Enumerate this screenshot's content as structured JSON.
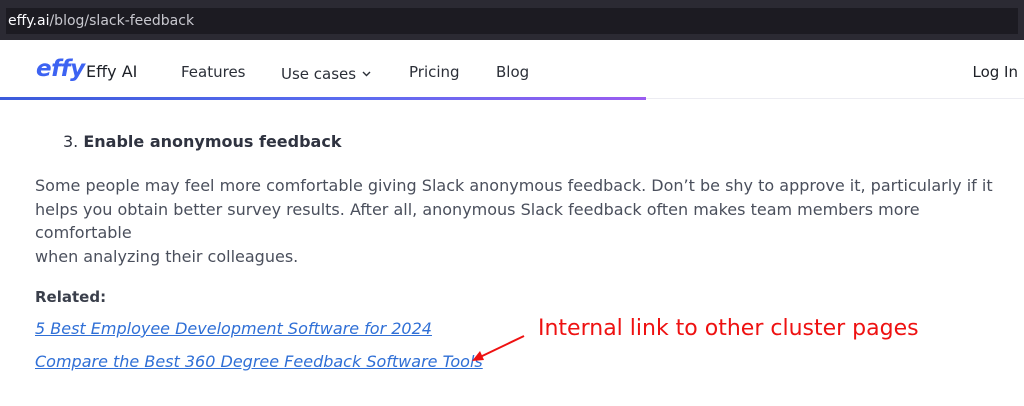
{
  "browser": {
    "url_host": "effy.ai",
    "url_path": "/blog/slack-feedback"
  },
  "nav": {
    "logo_text": "effy",
    "brand": "Effy AI",
    "links": [
      "Features",
      "Use cases",
      "Pricing",
      "Blog"
    ],
    "login": "Log In",
    "accent": "#3d63f2"
  },
  "article": {
    "step_number": "3.",
    "step_title": "Enable anonymous feedback",
    "paragraph_lines": [
      "Some people may feel more comfortable giving Slack anonymous feedback. Don’t be shy to approve it, particularly if it",
      "helps you obtain better survey results. After all, anonymous Slack feedback often makes team members more comfortable",
      "when analyzing their colleagues."
    ],
    "related_label": "Related:",
    "related_links": [
      "5 Best Employee Development Software for 2024",
      "Compare the Best 360 Degree Feedback Software Tools"
    ]
  },
  "annotation": {
    "text": "Internal link to other cluster pages",
    "color": "#ee1111"
  }
}
